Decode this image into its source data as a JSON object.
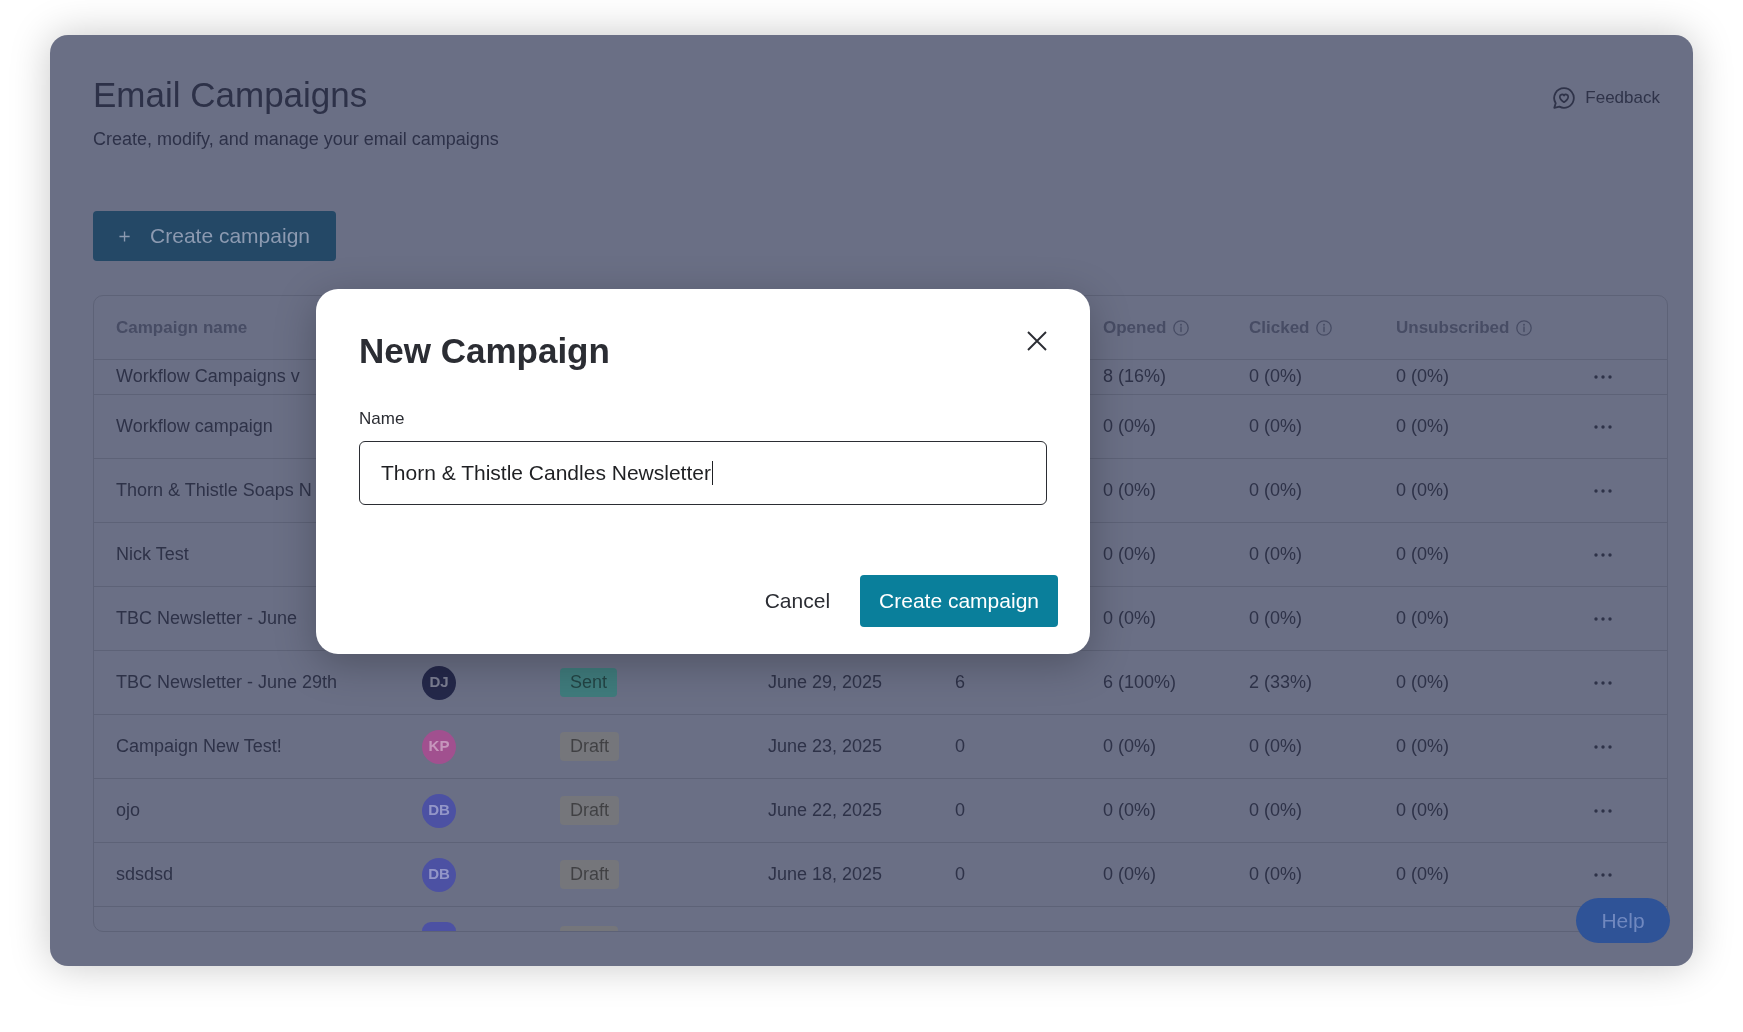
{
  "page": {
    "title": "Email Campaigns",
    "subtitle": "Create, modify, and manage your email campaigns",
    "feedback": "Feedback",
    "create_button": "Create campaign"
  },
  "table": {
    "columns": [
      {
        "kind": "name",
        "label": "Campaign name",
        "info": false
      },
      {
        "kind": "metric",
        "label": "Opened",
        "info": true
      },
      {
        "kind": "metric",
        "label": "Clicked",
        "info": true
      },
      {
        "kind": "metric",
        "label": "Unsubscribed",
        "info": true
      }
    ],
    "rows": [
      {
        "kind": "clipped",
        "name": "Workflow Campaigns v",
        "opened": "8 (16%)",
        "clicked": "0 (0%)",
        "unsubscribed": "0 (0%)"
      },
      {
        "kind": "covered",
        "name": "Workflow campaign",
        "opened": "0 (0%)",
        "clicked": "0 (0%)",
        "unsubscribed": "0 (0%)"
      },
      {
        "kind": "covered",
        "name": "Thorn & Thistle Soaps N",
        "opened": "0 (0%)",
        "clicked": "0 (0%)",
        "unsubscribed": "0 (0%)"
      },
      {
        "kind": "covered",
        "name": "Nick Test",
        "opened": "0 (0%)",
        "clicked": "0 (0%)",
        "unsubscribed": "0 (0%)"
      },
      {
        "kind": "covered",
        "name": "TBC Newsletter - June",
        "opened": "0 (0%)",
        "clicked": "0 (0%)",
        "unsubscribed": "0 (0%)"
      },
      {
        "kind": "full",
        "name": "TBC Newsletter - June 29th",
        "owner": {
          "initials": "DJ",
          "color": "#24284a"
        },
        "status": {
          "label": "Sent",
          "color": "#3f7b7c"
        },
        "date": "June 29, 2025",
        "recipients": "6",
        "opened": "6 (100%)",
        "clicked": "2 (33%)",
        "unsubscribed": "0 (0%)"
      },
      {
        "kind": "full",
        "name": "Campaign New Test!",
        "owner": {
          "initials": "KP",
          "color": "#a1508f"
        },
        "status": {
          "label": "Draft",
          "color": "#75767b"
        },
        "date": "June 23, 2025",
        "recipients": "0",
        "opened": "0 (0%)",
        "clicked": "0 (0%)",
        "unsubscribed": "0 (0%)"
      },
      {
        "kind": "full",
        "name": "ojo",
        "owner": {
          "initials": "DB",
          "color": "#4c51a3"
        },
        "status": {
          "label": "Draft",
          "color": "#75767b"
        },
        "date": "June 22, 2025",
        "recipients": "0",
        "opened": "0 (0%)",
        "clicked": "0 (0%)",
        "unsubscribed": "0 (0%)"
      },
      {
        "kind": "full",
        "name": "sdsdsd",
        "owner": {
          "initials": "DB",
          "color": "#4c51a3"
        },
        "status": {
          "label": "Draft",
          "color": "#75767b"
        },
        "date": "June 18, 2025",
        "recipients": "0",
        "opened": "0 (0%)",
        "clicked": "0 (0%)",
        "unsubscribed": "0 (0%)"
      },
      {
        "kind": "partial",
        "owner": {
          "color": "#4c51a3"
        },
        "status": {
          "color": "#75767b"
        }
      }
    ]
  },
  "dialog": {
    "title": "New Campaign",
    "field": {
      "label": "Name",
      "value": "Thorn & Thistle Candles Newsletter",
      "focused": true
    },
    "buttons": [
      {
        "kind": "secondary",
        "label": "Cancel"
      },
      {
        "kind": "primary",
        "label": "Create campaign"
      }
    ]
  },
  "help_button": "Help"
}
